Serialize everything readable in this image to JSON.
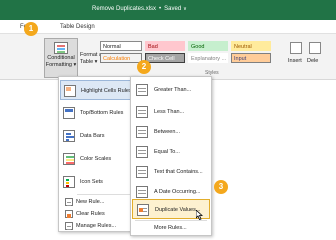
{
  "window": {
    "title": "Remove Duplicates.xlsx",
    "save_state": "Saved",
    "bullet": "•",
    "chevron": "∨"
  },
  "tabs": [
    "Fo",
    "Table Design"
  ],
  "ribbon": {
    "conditional_formatting_label": [
      "Conditional",
      "Formatting"
    ],
    "format_as_table_label": [
      "Format as",
      "Table"
    ],
    "styles_group_label": "Styles",
    "insert_label": "Insert",
    "delete_label": "Dele",
    "cell_styles": [
      {
        "label": "Normal",
        "bg": "#ffffff",
        "fg": "#222222",
        "border": "#8a8a8a"
      },
      {
        "label": "Bad",
        "bg": "#ffc7ce",
        "fg": "#9c0006",
        "border": "#ffc7ce"
      },
      {
        "label": "Good",
        "bg": "#c6efce",
        "fg": "#006100",
        "border": "#c6efce"
      },
      {
        "label": "Neutral",
        "bg": "#ffeb9c",
        "fg": "#9c5700",
        "border": "#ffeb9c"
      },
      {
        "label": "Calculation",
        "bg": "#f2f2f2",
        "fg": "#fa7d00",
        "border": "#7f7f7f"
      },
      {
        "label": "Check Cell",
        "bg": "#a5a5a5",
        "fg": "#ffffff",
        "border": "#3f3f3f"
      },
      {
        "label": "Explanatory ...",
        "bg": "#ffffff",
        "fg": "#7f7f7f",
        "border": "#ffffff"
      },
      {
        "label": "Input",
        "bg": "#ffcc99",
        "fg": "#3f3f76",
        "border": "#7f7f7f"
      }
    ]
  },
  "menu": {
    "items": [
      {
        "label": "Highlight Cells Rules",
        "icon": "highlight-cells-icon",
        "arrow": "›"
      },
      {
        "label": "Top/Bottom Rules",
        "icon": "top-bottom-icon",
        "arrow": "›"
      },
      {
        "label": "Data Bars",
        "icon": "data-bars-icon",
        "arrow": "›"
      },
      {
        "label": "Color Scales",
        "icon": "color-scales-icon",
        "arrow": "›"
      },
      {
        "label": "Icon Sets",
        "icon": "icon-sets-icon",
        "arrow": "›"
      }
    ],
    "small_items": [
      {
        "label": "New Rule...",
        "icon": "new-rule-icon"
      },
      {
        "label": "Clear Rules",
        "icon": "clear-rules-icon",
        "arrow": "›"
      },
      {
        "label": "Manage Rules...",
        "icon": "manage-rules-icon"
      }
    ]
  },
  "submenu": {
    "items": [
      {
        "label": "Greater Than...",
        "icon": "greater-than-icon"
      },
      {
        "label": "Less Than...",
        "icon": "less-than-icon"
      },
      {
        "label": "Between...",
        "icon": "between-icon"
      },
      {
        "label": "Equal To...",
        "icon": "equal-to-icon"
      },
      {
        "label": "Text that Contains...",
        "icon": "text-contains-icon"
      },
      {
        "label": "A Date Occurring...",
        "icon": "date-occurring-icon"
      },
      {
        "label": "Duplicate Values...",
        "icon": "duplicate-values-icon"
      }
    ],
    "more_rules": "More Rules..."
  },
  "badges": [
    "1",
    "2",
    "3"
  ],
  "colors": {
    "title_bar": "#217346",
    "badge": "#f4a81d",
    "hover_highlight": "#dde8f5",
    "selected_highlight": "#fdf1d0"
  }
}
